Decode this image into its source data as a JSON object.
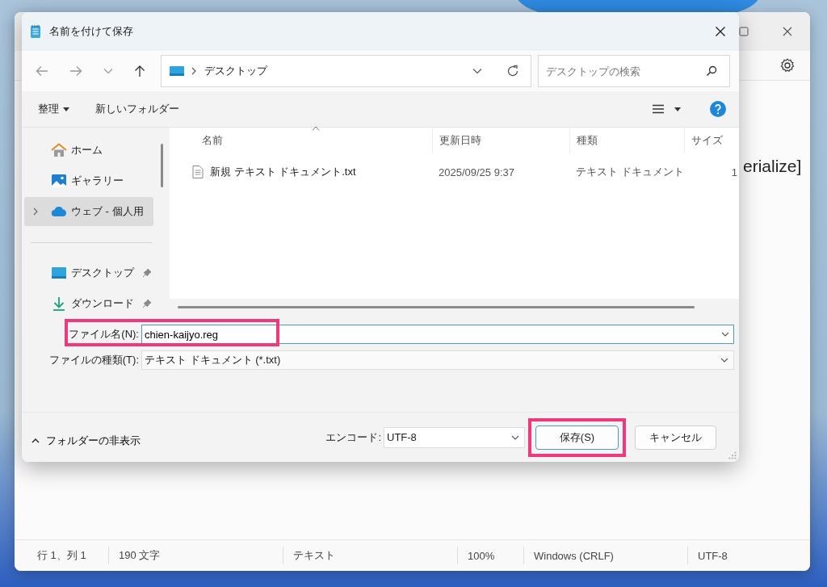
{
  "notepad": {
    "text_fragment": "erialize]",
    "status_bar": [
      "行 1、列 1",
      "190 文字",
      "テキスト",
      "100%",
      "Windows (CRLF)",
      "UTF-8"
    ]
  },
  "dialog": {
    "title": "名前を付けて保存",
    "address": {
      "path": "デスクトップ"
    },
    "search": {
      "placeholder": "デスクトップの検索"
    },
    "toolbar": {
      "organize": "整理",
      "new_folder": "新しいフォルダー"
    },
    "sidebar": {
      "groups": [
        {
          "items": [
            {
              "label": "ホーム",
              "kind": "home",
              "selected": false,
              "expandable": false,
              "pinned": false
            },
            {
              "label": "ギャラリー",
              "kind": "gallery",
              "selected": false,
              "expandable": false,
              "pinned": false
            },
            {
              "label": "ウェブ - 個人用",
              "kind": "cloud",
              "selected": true,
              "expandable": true,
              "pinned": false
            }
          ]
        },
        {
          "items": [
            {
              "label": "デスクトップ",
              "kind": "desktop",
              "selected": false,
              "expandable": false,
              "pinned": true
            },
            {
              "label": "ダウンロード",
              "kind": "download",
              "selected": false,
              "expandable": false,
              "pinned": true
            }
          ]
        }
      ]
    },
    "file_list": {
      "columns": [
        {
          "label": "名前",
          "sorted": true
        },
        {
          "label": "更新日時",
          "sorted": false
        },
        {
          "label": "種類",
          "sorted": false
        },
        {
          "label": "サイズ",
          "sorted": false
        }
      ],
      "rows": [
        {
          "cells": [
            "新規 テキスト ドキュメント.txt",
            "2025/09/25 9:37",
            "テキスト ドキュメント",
            "1"
          ],
          "selected": false
        }
      ]
    },
    "form": {
      "file_name": {
        "label": "ファイル名(N):",
        "value": "chien-kaijyo.reg",
        "highlighted": true
      },
      "file_type": {
        "label": "ファイルの種類(T):",
        "value": "テキスト ドキュメント (*.txt)",
        "highlighted": false
      }
    },
    "footer": {
      "hide_folders": "フォルダーの非表示",
      "encoding": {
        "label": "エンコード:",
        "value": "UTF-8"
      },
      "buttons": [
        {
          "label": "保存(S)",
          "default": true,
          "highlighted": true
        },
        {
          "label": "キャンセル",
          "default": false,
          "highlighted": false
        }
      ]
    }
  }
}
